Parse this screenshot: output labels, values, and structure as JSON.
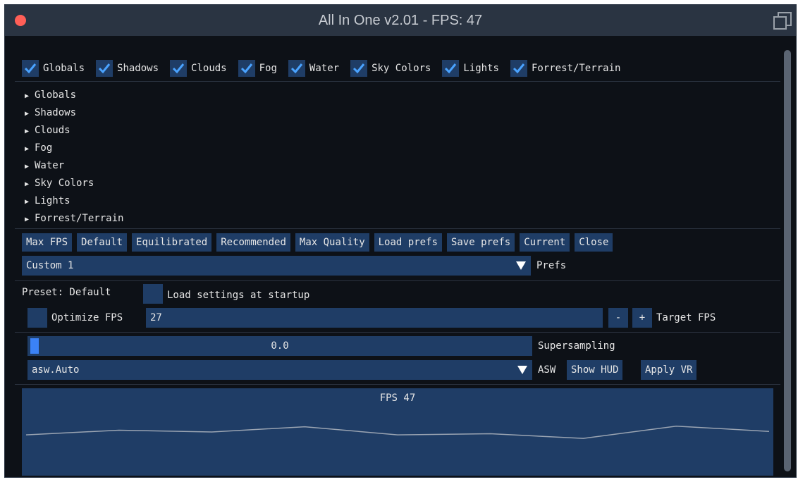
{
  "window": {
    "title": "All In One v2.01 - FPS: 47"
  },
  "categories": [
    {
      "label": "Globals",
      "checked": true
    },
    {
      "label": "Shadows",
      "checked": true
    },
    {
      "label": "Clouds",
      "checked": true
    },
    {
      "label": "Fog",
      "checked": true
    },
    {
      "label": "Water",
      "checked": true
    },
    {
      "label": "Sky Colors",
      "checked": true
    },
    {
      "label": "Lights",
      "checked": true
    },
    {
      "label": "Forrest/Terrain",
      "checked": true
    }
  ],
  "tree": [
    "Globals",
    "Shadows",
    "Clouds",
    "Fog",
    "Water",
    "Sky Colors",
    "Lights",
    "Forrest/Terrain"
  ],
  "buttons": [
    "Max FPS",
    "Default",
    "Equilibrated",
    "Recommended",
    "Max Quality",
    "Load prefs",
    "Save prefs",
    "Current",
    "Close"
  ],
  "prefs": {
    "selected": "Custom 1",
    "label": "Prefs"
  },
  "preset": {
    "text": "Preset: Default",
    "startup_label": "Load settings at startup"
  },
  "optimize": {
    "label": "Optimize FPS",
    "value": "27",
    "minus": "-",
    "plus": "+",
    "target_label": "Target FPS"
  },
  "supersampling": {
    "value": "0.0",
    "fraction": 0.0,
    "label": "Supersampling"
  },
  "asw": {
    "selected": "asw.Auto",
    "label": "ASW",
    "show_hud": "Show HUD",
    "apply_vr": "Apply VR"
  },
  "fps_plot": {
    "title": "FPS 47",
    "values": [
      47.0,
      47.8,
      47.5,
      48.4,
      47.0,
      47.2,
      46.4,
      48.5,
      47.6
    ]
  },
  "colors": {
    "accent": "#1f3d66",
    "check": "#4aa3ff",
    "close": "#ff5f57",
    "background": "#0d1117"
  }
}
